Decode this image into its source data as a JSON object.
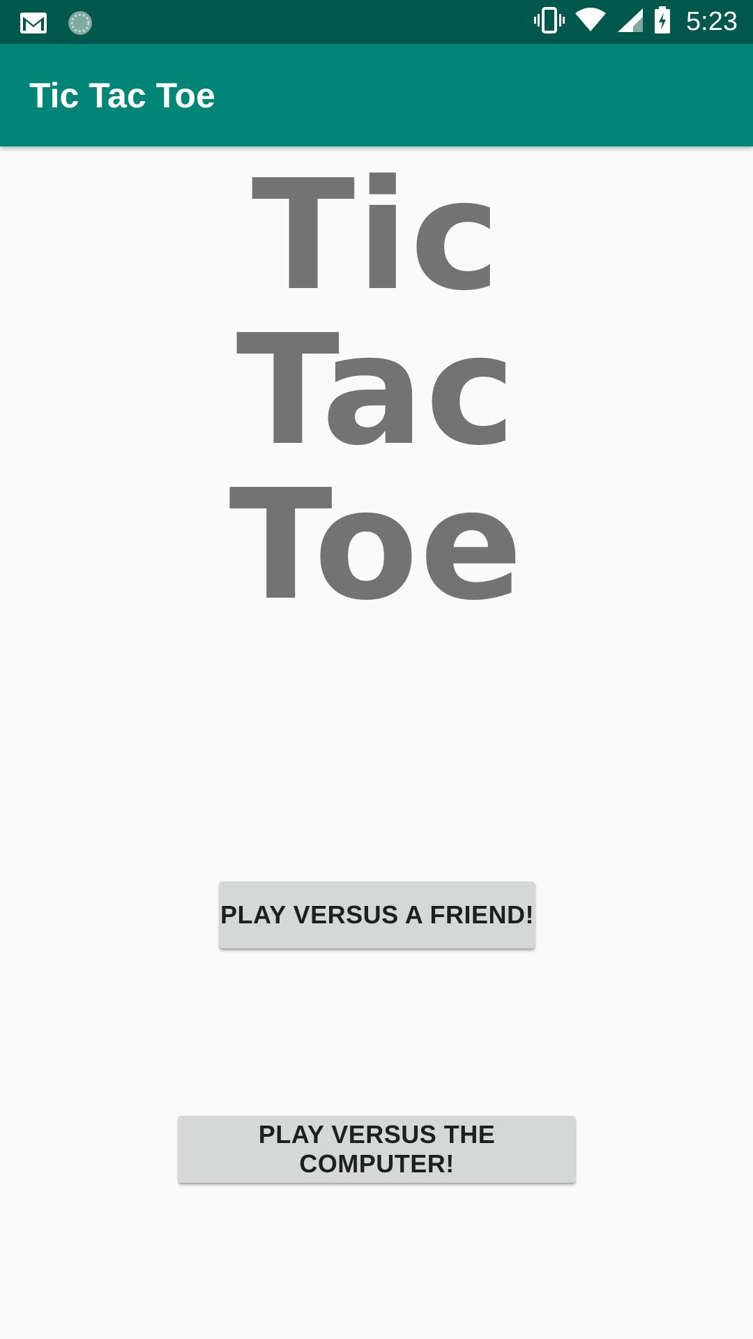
{
  "status_bar": {
    "time": "5:23",
    "icons": [
      "gmail-icon",
      "sync-icon",
      "vibrate-icon",
      "wifi-icon",
      "signal-icon",
      "battery-charging-icon"
    ]
  },
  "app_bar": {
    "title": "Tic Tac Toe"
  },
  "main": {
    "hero_title": "Tic Tac Toe",
    "buttons": {
      "play_friend": "PLAY VERSUS A FRIEND!",
      "play_computer": "PLAY VERSUS THE COMPUTER!"
    }
  },
  "colors": {
    "status_bar": "#00574b",
    "app_bar": "#008577",
    "background": "#fafafa",
    "hero_text": "#737373",
    "button_bg": "#d6d7d7"
  }
}
